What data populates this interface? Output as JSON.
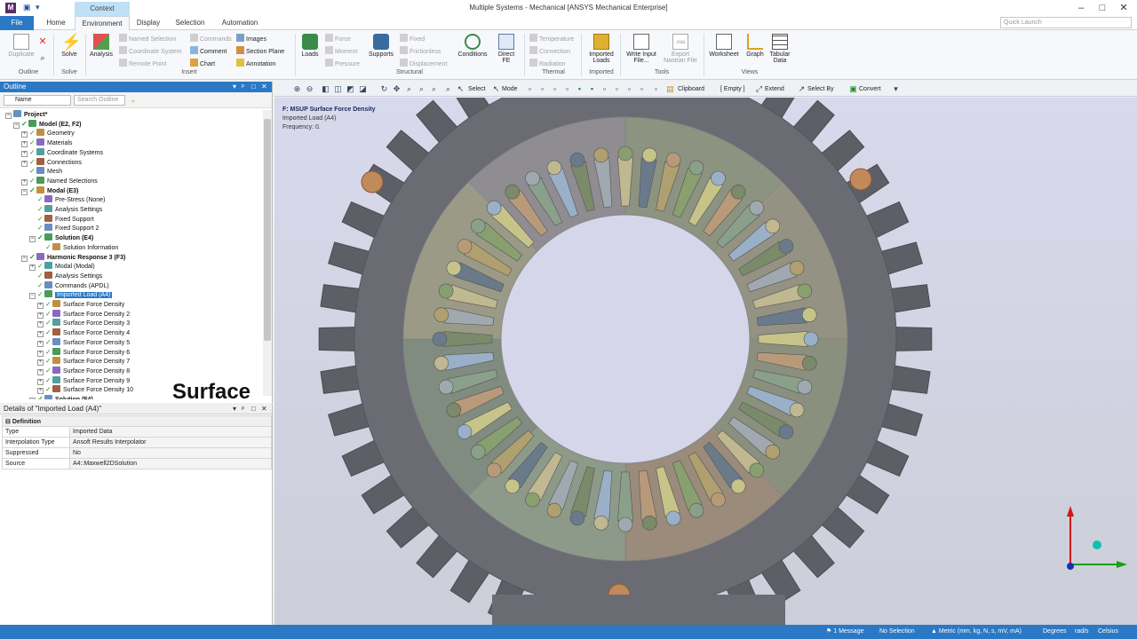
{
  "window": {
    "title": "Multiple Systems - Mechanical [ANSYS Mechanical Enterprise]",
    "context_tab": "Context"
  },
  "ribbon_tabs": [
    "File",
    "Home",
    "Environment",
    "Display",
    "Selection",
    "Automation"
  ],
  "active_tab": "Environment",
  "quick_launch_placeholder": "Quick Launch",
  "ribbon": {
    "outline": {
      "duplicate": "Duplicate",
      "label": "Outline"
    },
    "solve": {
      "solve": "Solve",
      "label": "Solve"
    },
    "insert": {
      "analysis": "Analysis",
      "named_selection": "Named Selection",
      "coordinate_system": "Coordinate System",
      "remote_point": "Remote Point",
      "commands": "Commands",
      "comment": "Comment",
      "chart": "Chart",
      "images": "Images",
      "section_plane": "Section Plane",
      "annotation": "Annotation",
      "label": "Insert"
    },
    "structural": {
      "loads": "Loads",
      "force": "Force",
      "moment": "Moment",
      "pressure": "Pressure",
      "supports": "Supports",
      "fixed": "Fixed",
      "frictionless": "Frictionless",
      "displacement": "Displacement",
      "conditions": "Conditions",
      "direct_fe": "Direct FE",
      "label": "Structural"
    },
    "thermal": {
      "temperature": "Temperature",
      "convection": "Convection",
      "radiation": "Radiation",
      "label": "Thermal"
    },
    "imported": {
      "imported_loads": "Imported Loads",
      "label": "Imported"
    },
    "tools": {
      "write_input_file": "Write Input File...",
      "export_nastran": "Export Nastran File",
      "nas_badge": ".nas",
      "label": "Tools"
    },
    "views": {
      "worksheet": "Worksheet",
      "graph": "Graph",
      "tabular_data": "Tabular Data",
      "label": "Views"
    }
  },
  "outline": {
    "header": "Outline",
    "name_filter": "Name",
    "search_placeholder": "Search Outline",
    "tree": [
      {
        "label": "Project*",
        "level": 0,
        "bold": true,
        "exp": "-",
        "icon": "project-icon"
      },
      {
        "label": "Model (E2, F2)",
        "level": 1,
        "bold": true,
        "exp": "-",
        "icon": "model-icon"
      },
      {
        "label": "Geometry",
        "level": 2,
        "exp": "+",
        "icon": "geometry-icon"
      },
      {
        "label": "Materials",
        "level": 2,
        "exp": "+",
        "icon": "materials-icon"
      },
      {
        "label": "Coordinate Systems",
        "level": 2,
        "exp": "+",
        "icon": "coordinate-systems-icon"
      },
      {
        "label": "Connections",
        "level": 2,
        "exp": "+",
        "icon": "connections-icon"
      },
      {
        "label": "Mesh",
        "level": 2,
        "exp": "",
        "icon": "mesh-icon"
      },
      {
        "label": "Named Selections",
        "level": 2,
        "exp": "+",
        "icon": "named-selections-icon"
      },
      {
        "label": "Modal (E3)",
        "level": 2,
        "bold": true,
        "exp": "-",
        "icon": "modal-icon"
      },
      {
        "label": "Pre-Stress (None)",
        "level": 3,
        "exp": "",
        "icon": "prestress-icon"
      },
      {
        "label": "Analysis Settings",
        "level": 3,
        "exp": "",
        "icon": "analysis-settings-icon"
      },
      {
        "label": "Fixed Support",
        "level": 3,
        "exp": "",
        "icon": "fixed-support-icon"
      },
      {
        "label": "Fixed Support 2",
        "level": 3,
        "exp": "",
        "icon": "fixed-support-icon"
      },
      {
        "label": "Solution (E4)",
        "level": 3,
        "bold": true,
        "exp": "-",
        "icon": "solution-icon"
      },
      {
        "label": "Solution Information",
        "level": 4,
        "exp": "",
        "icon": "solution-information-icon"
      },
      {
        "label": "Harmonic Response 3 (F3)",
        "level": 2,
        "bold": true,
        "exp": "-",
        "icon": "harmonic-icon"
      },
      {
        "label": "Modal (Modal)",
        "level": 3,
        "exp": "+",
        "icon": "modal-icon"
      },
      {
        "label": "Analysis Settings",
        "level": 3,
        "exp": "",
        "icon": "analysis-settings-icon"
      },
      {
        "label": "Commands (APDL)",
        "level": 3,
        "exp": "",
        "icon": "commands-icon"
      },
      {
        "label": "Imported Load (A4)",
        "level": 3,
        "exp": "-",
        "icon": "imported-load-icon",
        "selected": true
      },
      {
        "label": "Surface Force Density",
        "level": 4,
        "exp": "+",
        "icon": "surface-force-icon"
      },
      {
        "label": "Surface Force Density 2",
        "level": 4,
        "exp": "+",
        "icon": "surface-force-icon"
      },
      {
        "label": "Surface Force Density 3",
        "level": 4,
        "exp": "+",
        "icon": "surface-force-icon"
      },
      {
        "label": "Surface Force Density 4",
        "level": 4,
        "exp": "+",
        "icon": "surface-force-icon"
      },
      {
        "label": "Surface Force Density 5",
        "level": 4,
        "exp": "+",
        "icon": "surface-force-icon"
      },
      {
        "label": "Surface Force Density 6",
        "level": 4,
        "exp": "+",
        "icon": "surface-force-icon"
      },
      {
        "label": "Surface Force Density 7",
        "level": 4,
        "exp": "+",
        "icon": "surface-force-icon"
      },
      {
        "label": "Surface Force Density 8",
        "level": 4,
        "exp": "+",
        "icon": "surface-force-icon"
      },
      {
        "label": "Surface Force Density 9",
        "level": 4,
        "exp": "+",
        "icon": "surface-force-icon"
      },
      {
        "label": "Surface Force Density 10",
        "level": 4,
        "exp": "+",
        "icon": "surface-force-icon"
      },
      {
        "label": "Solution (F4)",
        "level": 3,
        "bold": true,
        "exp": "-",
        "icon": "solution-icon"
      }
    ]
  },
  "overlay_caption": "Surface Force Density",
  "details": {
    "header": "Details of \"Imported Load (A4)\"",
    "category": "Definition",
    "rows": [
      {
        "key": "Type",
        "value": "Imported Data"
      },
      {
        "key": "Interpolation Type",
        "value": "Ansoft Results Interpolator"
      },
      {
        "key": "Suppressed",
        "value": "No"
      },
      {
        "key": "Source",
        "value": "A4::Maxwell2DSolution"
      }
    ]
  },
  "graphics_toolbar": {
    "select": "Select",
    "mode": "Mode",
    "clipboard": "Clipboard",
    "empty": "[ Empty ]",
    "extend": "Extend",
    "select_by": "Select By",
    "convert": "Convert"
  },
  "viewport": {
    "annotation_title": "F: MSUP Surface Force Density",
    "annotation_line2": "Imported Load (A4)",
    "annotation_line3": "Frequency: 0."
  },
  "status": {
    "messages": "1 Message",
    "selection": "No Selection",
    "units": "Metric (mm, kg, N, s, mV, mA)",
    "angle": "Degrees",
    "rate": "rad/s",
    "temperature": "Celsius"
  },
  "colors": {
    "accent": "#2b78c5",
    "housing": "#6a6b73",
    "stator": "#9a9ba3",
    "bore": "#d5d6ea"
  }
}
